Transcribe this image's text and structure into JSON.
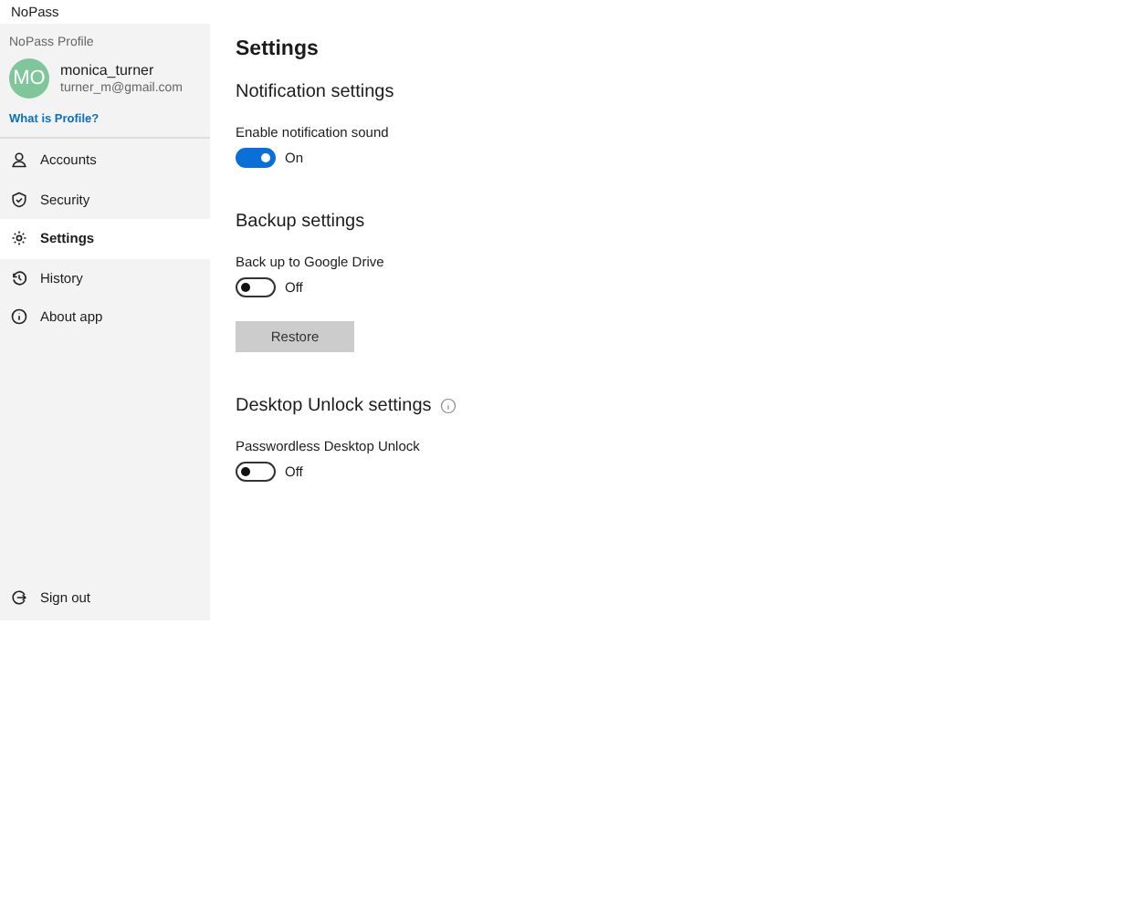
{
  "window": {
    "title": "NoPass"
  },
  "profile": {
    "heading": "NoPass Profile",
    "initials": "MO",
    "name": "monica_turner",
    "email": "turner_m@gmail.com",
    "link": "What is Profile?"
  },
  "nav": [
    {
      "label": "Accounts",
      "kind": "user",
      "selected": false
    },
    {
      "label": "Security",
      "kind": "shield",
      "selected": false
    },
    {
      "label": "Settings",
      "kind": "gear",
      "selected": true
    },
    {
      "label": "History",
      "kind": "history",
      "selected": false
    },
    {
      "label": "About app",
      "kind": "info",
      "selected": false
    }
  ],
  "sign_out": {
    "label": "Sign out"
  },
  "page_title": "Settings",
  "sections": [
    {
      "title": "Notification settings",
      "info": false,
      "items": [
        {
          "kind": "toggle",
          "label": "Enable notification sound",
          "on": true,
          "state_text": "On"
        }
      ]
    },
    {
      "title": "Backup settings",
      "info": false,
      "items": [
        {
          "kind": "toggle",
          "label": "Back up to Google Drive",
          "on": false,
          "state_text": "Off"
        },
        {
          "kind": "button",
          "label": "Restore"
        }
      ]
    },
    {
      "title": "Desktop Unlock settings",
      "info": true,
      "items": [
        {
          "kind": "toggle",
          "label": "Passwordless Desktop Unlock",
          "on": false,
          "state_text": "Off"
        }
      ]
    }
  ]
}
